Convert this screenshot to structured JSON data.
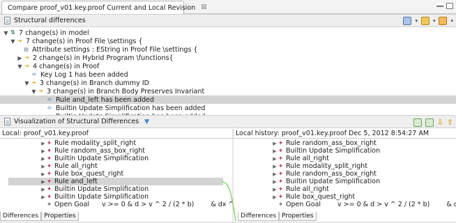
{
  "window": {
    "tab_title": "Compare proof_v01.key.proof Current and Local Revision",
    "tab_close": "☒"
  },
  "structural": {
    "header": "Structural differences",
    "tree": [
      {
        "label": "7 change(s) in model",
        "icon": "model-icon",
        "expanded": true
      },
      {
        "label": "7 change(s) in Proof File \\settings {",
        "icon": "change-icon",
        "expanded": true
      },
      {
        "label": "Attribute settings : EString in Proof File \\settings {",
        "icon": "attribute-icon",
        "expanded": false
      },
      {
        "label": "2 change(s) in Hybrid Program \\functions{",
        "icon": "change-icon",
        "expanded": false
      },
      {
        "label": "4 change(s) in Proof",
        "icon": "change-icon",
        "expanded": true
      },
      {
        "label": "Key Log 1 has been added",
        "icon": "add-icon",
        "expanded": false
      },
      {
        "label": "3 change(s) in Branch dummy ID",
        "icon": "change-icon",
        "expanded": true
      },
      {
        "label": "3 change(s) in Branch  Body Preserves Invariant",
        "icon": "change-icon",
        "expanded": true
      },
      {
        "label": "Rule and_left has been added",
        "icon": "add-icon",
        "expanded": false,
        "selected": true
      },
      {
        "label": "Builtin Update Simplification has been added",
        "icon": "add-icon",
        "expanded": false
      },
      {
        "label": "Builtin Update Simplification has been added",
        "icon": "add-icon",
        "expanded": false
      }
    ]
  },
  "visualization": {
    "header": "Visualization of Structural Differences"
  },
  "left_panel": {
    "title": "Local: proof_v01.key.proof",
    "rows": [
      {
        "label": "Rule modality_split_right"
      },
      {
        "label": "Rule random_ass_box_right"
      },
      {
        "label": "Builtin Update Simplification"
      },
      {
        "label": "Rule all_right"
      },
      {
        "label": "Rule box_quest_right"
      },
      {
        "label": "Rule and_left",
        "selected": true
      },
      {
        "label": "Builtin Update Simplification"
      },
      {
        "label": "Builtin Update Simplification"
      }
    ],
    "goal": {
      "label": "Open Goal",
      "formula": "v >= 0 & d >  v ^ 2 / (2 * b)",
      "tail": "& dx ^"
    },
    "tabs": [
      "Differences",
      "Properties"
    ]
  },
  "right_panel": {
    "title": "Local history: proof_v01.key.proof Dec 5, 2012 8:54:27 AM",
    "rows": [
      {
        "label": "Rule random_ass_box_right"
      },
      {
        "label": "Builtin Update Simplification"
      },
      {
        "label": "Rule all_right"
      },
      {
        "label": "Rule modality_split_right"
      },
      {
        "label": "Rule random_ass_box_right"
      },
      {
        "label": "Builtin Update Simplification"
      },
      {
        "label": "Rule all_right"
      },
      {
        "label": "Rule box_quest_right"
      }
    ],
    "goal": {
      "label": "Open Goal",
      "formula": "v >= 0 & d >  v ^ 2 / (2 * b)",
      "tail": "& dx ^"
    },
    "tabs": [
      "Differences",
      "Properties"
    ]
  },
  "colors": {
    "accent_blue": "#3b82d6",
    "change_orange": "#e2a21a",
    "rule_pink": "#c2446a",
    "connector_green": "#7ccf5a"
  }
}
